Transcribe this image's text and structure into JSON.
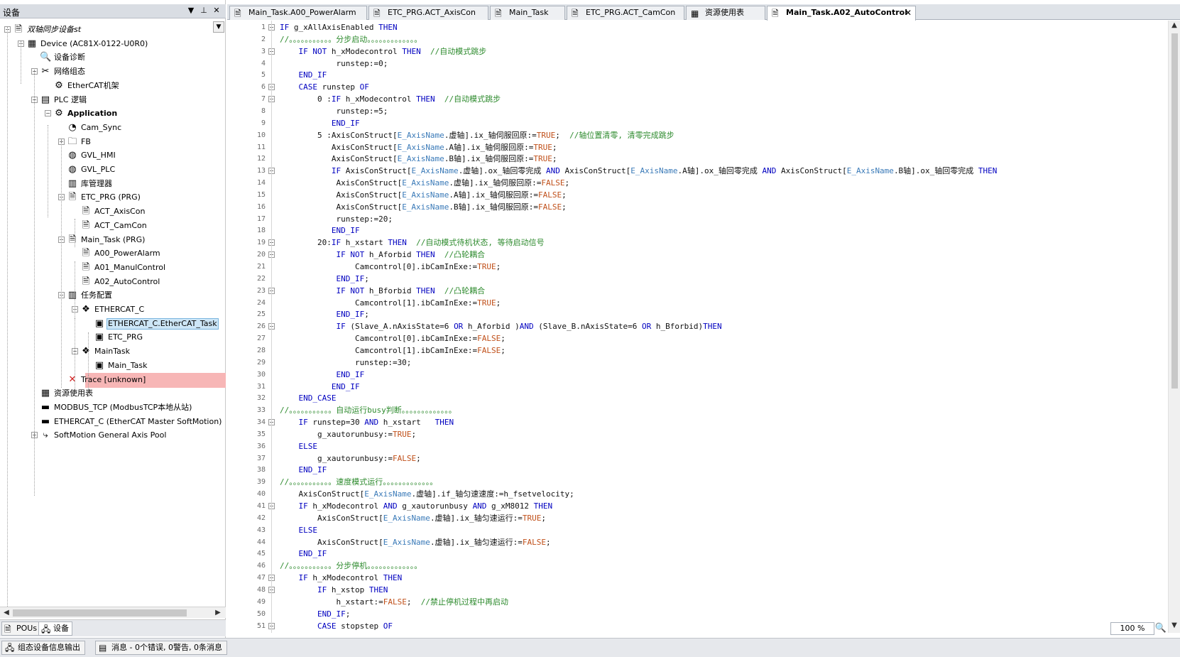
{
  "panel": {
    "title": "设备",
    "dropdown_icon": "chevron-down-icon",
    "pin_icon": "pin-icon",
    "close_icon": "close-icon"
  },
  "tree": [
    {
      "label": "双轴同步设备st",
      "icon": "project-icon",
      "glyph": "🗎",
      "indent": 0,
      "expand": "−",
      "italic": true
    },
    {
      "label": "Device (AC81X-0122-U0R0)",
      "icon": "device-icon",
      "glyph": "▦",
      "indent": 1,
      "expand": "−"
    },
    {
      "label": "设备诊断",
      "icon": "diagnostic-icon",
      "glyph": "🔍",
      "indent": 2,
      "expand": ""
    },
    {
      "label": "网络组态",
      "icon": "network-icon",
      "glyph": "✂",
      "indent": 2,
      "expand": "−"
    },
    {
      "label": "EtherCAT机架",
      "icon": "rack-icon",
      "glyph": "⚙",
      "indent": 3,
      "expand": ""
    },
    {
      "label": "PLC 逻辑",
      "icon": "plc-icon",
      "glyph": "▤",
      "indent": 2,
      "expand": "−"
    },
    {
      "label": "Application",
      "icon": "application-icon",
      "glyph": "⚙",
      "indent": 3,
      "expand": "−",
      "bold": true
    },
    {
      "label": "Cam_Sync",
      "icon": "cam-icon",
      "glyph": "◔",
      "indent": 4,
      "expand": ""
    },
    {
      "label": "FB",
      "icon": "folder-icon",
      "glyph": "🗀",
      "indent": 4,
      "expand": "+"
    },
    {
      "label": "GVL_HMI",
      "icon": "globe-icon",
      "glyph": "◍",
      "indent": 4,
      "expand": ""
    },
    {
      "label": "GVL_PLC",
      "icon": "globe-icon",
      "glyph": "◍",
      "indent": 4,
      "expand": ""
    },
    {
      "label": "库管理器",
      "icon": "library-icon",
      "glyph": "▥",
      "indent": 4,
      "expand": ""
    },
    {
      "label": "ETC_PRG (PRG)",
      "icon": "program-icon",
      "glyph": "🗎",
      "indent": 4,
      "expand": "−"
    },
    {
      "label": "ACT_AxisCon",
      "icon": "action-icon",
      "glyph": "🗎",
      "indent": 5,
      "expand": ""
    },
    {
      "label": "ACT_CamCon",
      "icon": "action-icon",
      "glyph": "🗎",
      "indent": 5,
      "expand": ""
    },
    {
      "label": "Main_Task (PRG)",
      "icon": "program-icon",
      "glyph": "🗎",
      "indent": 4,
      "expand": "−"
    },
    {
      "label": "A00_PowerAlarm",
      "icon": "action-icon",
      "glyph": "🗎",
      "indent": 5,
      "expand": ""
    },
    {
      "label": "A01_ManulControl",
      "icon": "action-icon",
      "glyph": "🗎",
      "indent": 5,
      "expand": ""
    },
    {
      "label": "A02_AutoControl",
      "icon": "action-icon",
      "glyph": "🗎",
      "indent": 5,
      "expand": ""
    },
    {
      "label": "任务配置",
      "icon": "task-config-icon",
      "glyph": "▥",
      "indent": 4,
      "expand": "−"
    },
    {
      "label": "ETHERCAT_C",
      "icon": "task-icon",
      "glyph": "❖",
      "indent": 5,
      "expand": "−"
    },
    {
      "label": "ETHERCAT_C.EtherCAT_Task",
      "icon": "task-call-icon",
      "glyph": "▣",
      "indent": 6,
      "expand": "",
      "selected": true
    },
    {
      "label": "ETC_PRG",
      "icon": "task-call-icon",
      "glyph": "▣",
      "indent": 6,
      "expand": ""
    },
    {
      "label": "MainTask",
      "icon": "task-icon",
      "glyph": "❖",
      "indent": 5,
      "expand": "−"
    },
    {
      "label": "Main_Task",
      "icon": "task-call-icon",
      "glyph": "▣",
      "indent": 6,
      "expand": ""
    },
    {
      "label": "Trace [unknown]",
      "icon": "error-x-icon",
      "glyph": "✕",
      "indent": 4,
      "expand": "",
      "error": true
    },
    {
      "label": "资源使用表",
      "icon": "table-icon",
      "glyph": "▦",
      "indent": 2,
      "expand": ""
    },
    {
      "label": "MODBUS_TCP (ModbusTCP本地从站)",
      "icon": "modbus-icon",
      "glyph": "▬",
      "indent": 2,
      "expand": ""
    },
    {
      "label": "ETHERCAT_C (EtherCAT Master SoftMotion)",
      "icon": "ethercat-icon",
      "glyph": "▬",
      "indent": 2,
      "expand": ""
    },
    {
      "label": "SoftMotion General Axis Pool",
      "icon": "axis-pool-icon",
      "glyph": "⤷",
      "indent": 2,
      "expand": "+"
    }
  ],
  "bottom_tabs": [
    {
      "label": "POUs",
      "icon": "pou-icon",
      "glyph": "🗎"
    },
    {
      "label": "设备",
      "icon": "devices-icon",
      "glyph": "🖧"
    }
  ],
  "editor_tabs": [
    {
      "label": "Main_Task.A00_PowerAlarm",
      "icon": "action-icon",
      "glyph": "🗎",
      "active": false
    },
    {
      "label": "ETC_PRG.ACT_AxisCon",
      "icon": "action-icon",
      "glyph": "🗎",
      "active": false
    },
    {
      "label": "Main_Task",
      "icon": "program-icon",
      "glyph": "🗎",
      "active": false
    },
    {
      "label": "ETC_PRG.ACT_CamCon",
      "icon": "action-icon",
      "glyph": "🗎",
      "active": false
    },
    {
      "label": "资源使用表",
      "icon": "table-icon",
      "glyph": "▦",
      "active": false
    },
    {
      "label": "Main_Task.A02_AutoControl",
      "icon": "action-icon",
      "glyph": "🗎",
      "active": true,
      "close": "✕"
    }
  ],
  "code_lines": [
    {
      "n": "1",
      "fold": "−",
      "text": "IF g_xAllAxisEnabled THEN"
    },
    {
      "n": "2",
      "fold": "",
      "text": "//。。。。。。。。。。。分步启动。。。。。。。。。。。。。"
    },
    {
      "n": "3",
      "fold": "−",
      "text": "    IF NOT h_xModecontrol THEN  //自动模式跳步"
    },
    {
      "n": "4",
      "fold": "",
      "text": "            runstep:=0;"
    },
    {
      "n": "5",
      "fold": "",
      "text": "    END_IF"
    },
    {
      "n": "6",
      "fold": "−",
      "text": "    CASE runstep OF"
    },
    {
      "n": "7",
      "fold": "−",
      "text": "        0 :IF h_xModecontrol THEN  //自动模式跳步"
    },
    {
      "n": "8",
      "fold": "",
      "text": "            runstep:=5;"
    },
    {
      "n": "9",
      "fold": "",
      "text": "           END_IF"
    },
    {
      "n": "10",
      "fold": "",
      "text": "        5 :AxisConStruct[E_AxisName.虚轴].ix_轴伺服回原:=TRUE;  //轴位置清零, 清零完成跳步"
    },
    {
      "n": "11",
      "fold": "",
      "text": "           AxisConStruct[E_AxisName.A轴].ix_轴伺服回原:=TRUE;"
    },
    {
      "n": "12",
      "fold": "",
      "text": "           AxisConStruct[E_AxisName.B轴].ix_轴伺服回原:=TRUE;"
    },
    {
      "n": "13",
      "fold": "−",
      "text": "           IF AxisConStruct[E_AxisName.虚轴].ox_轴回零完成 AND AxisConStruct[E_AxisName.A轴].ox_轴回零完成 AND AxisConStruct[E_AxisName.B轴].ox_轴回零完成 THEN"
    },
    {
      "n": "14",
      "fold": "",
      "text": "            AxisConStruct[E_AxisName.虚轴].ix_轴伺服回原:=FALSE;"
    },
    {
      "n": "15",
      "fold": "",
      "text": "            AxisConStruct[E_AxisName.A轴].ix_轴伺服回原:=FALSE;"
    },
    {
      "n": "16",
      "fold": "",
      "text": "            AxisConStruct[E_AxisName.B轴].ix_轴伺服回原:=FALSE;"
    },
    {
      "n": "17",
      "fold": "",
      "text": "            runstep:=20;"
    },
    {
      "n": "18",
      "fold": "",
      "text": "           END_IF"
    },
    {
      "n": "19",
      "fold": "−",
      "text": "        20:IF h_xstart THEN  //自动模式待机状态, 等待启动信号"
    },
    {
      "n": "20",
      "fold": "−",
      "text": "            IF NOT h_Aforbid THEN  //凸轮耦合"
    },
    {
      "n": "21",
      "fold": "",
      "text": "                Camcontrol[0].ibCamInExe:=TRUE;"
    },
    {
      "n": "22",
      "fold": "",
      "text": "            END_IF;"
    },
    {
      "n": "23",
      "fold": "−",
      "text": "            IF NOT h_Bforbid THEN  //凸轮耦合"
    },
    {
      "n": "24",
      "fold": "",
      "text": "                Camcontrol[1].ibCamInExe:=TRUE;"
    },
    {
      "n": "25",
      "fold": "",
      "text": "            END_IF;"
    },
    {
      "n": "26",
      "fold": "−",
      "text": "            IF (Slave_A.nAxisState=6 OR h_Aforbid )AND (Slave_B.nAxisState=6 OR h_Bforbid)THEN"
    },
    {
      "n": "27",
      "fold": "",
      "text": "                Camcontrol[0].ibCamInExe:=FALSE;"
    },
    {
      "n": "28",
      "fold": "",
      "text": "                Camcontrol[1].ibCamInExe:=FALSE;"
    },
    {
      "n": "29",
      "fold": "",
      "text": "                runstep:=30;"
    },
    {
      "n": "30",
      "fold": "",
      "text": "            END_IF"
    },
    {
      "n": "31",
      "fold": "",
      "text": "           END_IF"
    },
    {
      "n": "32",
      "fold": "",
      "text": "    END_CASE"
    },
    {
      "n": "33",
      "fold": "",
      "text": "//。。。。。。。。。。。自动运行busy判断。。。。。。。。。。。。。"
    },
    {
      "n": "34",
      "fold": "−",
      "text": "    IF runstep=30 AND h_xstart   THEN"
    },
    {
      "n": "35",
      "fold": "",
      "text": "        g_xautorunbusy:=TRUE;"
    },
    {
      "n": "36",
      "fold": "",
      "text": "    ELSE"
    },
    {
      "n": "37",
      "fold": "",
      "text": "        g_xautorunbusy:=FALSE;"
    },
    {
      "n": "38",
      "fold": "",
      "text": "    END_IF"
    },
    {
      "n": "39",
      "fold": "",
      "text": "//。。。。。。。。。。。速度模式运行。。。。。。。。。。。。。"
    },
    {
      "n": "40",
      "fold": "",
      "text": "    AxisConStruct[E_AxisName.虚轴].if_轴匀速速度:=h_fsetvelocity;"
    },
    {
      "n": "41",
      "fold": "−",
      "text": "    IF h_xModecontrol AND g_xautorunbusy AND g_xM8012 THEN"
    },
    {
      "n": "42",
      "fold": "",
      "text": "        AxisConStruct[E_AxisName.虚轴].ix_轴匀速运行:=TRUE;"
    },
    {
      "n": "43",
      "fold": "",
      "text": "    ELSE"
    },
    {
      "n": "44",
      "fold": "",
      "text": "        AxisConStruct[E_AxisName.虚轴].ix_轴匀速运行:=FALSE;"
    },
    {
      "n": "45",
      "fold": "",
      "text": "    END_IF"
    },
    {
      "n": "46",
      "fold": "",
      "text": "//。。。。。。。。。。。分步停机。。。。。。。。。。。。。"
    },
    {
      "n": "47",
      "fold": "−",
      "text": "    IF h_xModecontrol THEN"
    },
    {
      "n": "48",
      "fold": "−",
      "text": "        IF h_xstop THEN"
    },
    {
      "n": "49",
      "fold": "",
      "text": "            h_xstart:=FALSE;  //禁止停机过程中再启动"
    },
    {
      "n": "50",
      "fold": "",
      "text": "        END_IF;"
    },
    {
      "n": "51",
      "fold": "−",
      "text": "        CASE stopstep OF"
    }
  ],
  "zoom": "100 %",
  "status": [
    {
      "label": "组态设备信息输出",
      "icon": "device-output-icon",
      "glyph": "🖧"
    },
    {
      "label": "消息 - 0个错误, 0警告, 0条消息",
      "icon": "message-icon",
      "glyph": "▤"
    }
  ]
}
